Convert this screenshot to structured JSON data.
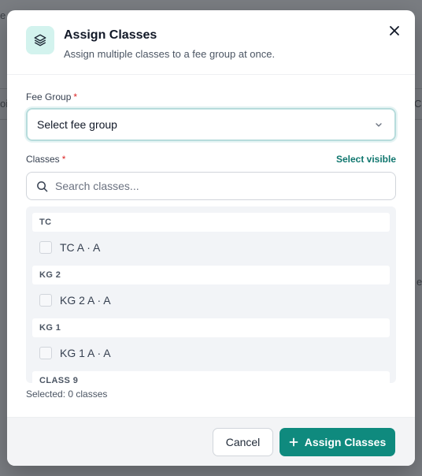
{
  "background": {
    "fragments": [
      "e",
      "oi",
      "Cl",
      "e"
    ]
  },
  "modal": {
    "title": "Assign Classes",
    "subtitle": "Assign multiple classes to a fee group at once.",
    "header_icon": "layers-icon",
    "close_icon": "close-icon"
  },
  "fee_group": {
    "label": "Fee Group",
    "required_mark": "*",
    "placeholder": "Select fee group"
  },
  "classes": {
    "label": "Classes",
    "required_mark": "*",
    "select_visible": "Select visible",
    "search_placeholder": "Search classes...",
    "groups": [
      {
        "name": "TC",
        "items": [
          {
            "label": "TC A · A",
            "checked": false
          }
        ]
      },
      {
        "name": "KG 2",
        "items": [
          {
            "label": "KG 2 A · A",
            "checked": false
          }
        ]
      },
      {
        "name": "KG 1",
        "items": [
          {
            "label": "KG 1 A · A",
            "checked": false
          }
        ]
      },
      {
        "name": "CLASS 9",
        "items": []
      }
    ],
    "selected_text": "Selected: 0 classes"
  },
  "footer": {
    "cancel_label": "Cancel",
    "assign_label": "Assign Classes"
  },
  "colors": {
    "accent": "#0f8a7e",
    "accent_light": "#d3f3ee",
    "required": "#dc2626"
  }
}
